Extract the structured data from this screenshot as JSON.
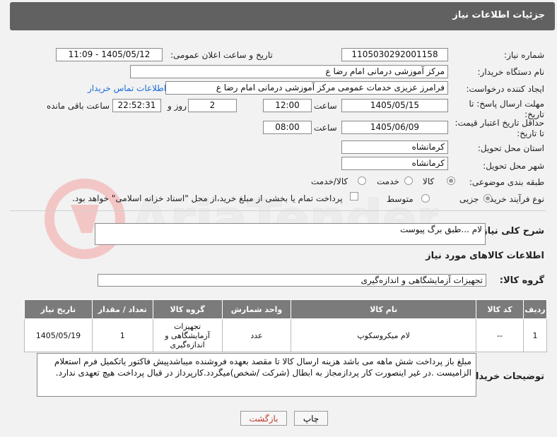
{
  "header": {
    "title": "جزئیات اطلاعات نیاز"
  },
  "fields": {
    "need_number_label": "شماره نیاز:",
    "need_number": "1105030292001158",
    "announce_label": "تاریخ و ساعت اعلان عمومی:",
    "announce_value": "1405/05/12 - 11:09",
    "buyer_org_label": "نام دستگاه خریدار:",
    "buyer_org": "مرکز آموزشی  درمانی امام رضا  ع",
    "requester_label": "ایجاد کننده درخواست:",
    "requester": "فرامرز عزیزی خدمات عمومی مرکز آموزشی  درمانی امام رضا  ع",
    "contact_link": "اطلاعات تماس خریدار",
    "deadline_label": "مهلت ارسال پاسخ: تا تاریخ:",
    "deadline_date": "1405/05/15",
    "time_label": "ساعت",
    "deadline_time": "12:00",
    "days_value": "2",
    "days_label": "روز و",
    "remaining_value": "22:52:31",
    "remaining_label": "ساعت باقی مانده",
    "price_validity_label": "حداقل تاریخ اعتبار قیمت: تا تاریخ:",
    "price_date": "1405/06/09",
    "price_time": "08:00",
    "province_label": "استان محل تحویل:",
    "province": "کرمانشاه",
    "city_label": "شهر محل تحویل:",
    "city": "کرمانشاه",
    "category_label": "طبقه بندی موضوعی:",
    "category_options": [
      "کالا",
      "خدمت",
      "کالا/خدمت"
    ],
    "process_label": "نوع فرآیند خرید :",
    "process_options": [
      "جزیی",
      "متوسط"
    ],
    "payment_note": "پرداخت تمام یا بخشی از مبلغ خرید،از محل \"اسناد خزانه اسلامی\" خواهد بود.",
    "description_label": "شرح کلی نیاز:",
    "description": "لام ...طبق برگ پیوست",
    "items_section": "اطلاعات کالاهای مورد نیاز",
    "group_label": "گروه کالا:",
    "group_value": "تجهیزات آزمایشگاهی و اندازه‌گیری",
    "buyer_notes_label": "توضیحات خریدار:",
    "buyer_notes": "مبلغ باز پرداخت شش ماهه می باشد هزینه ارسال کالا تا مقصد بعهده فروشنده میباشدپیش فاکتور یاتکمیل فرم استعلام الزامیست .در غیر اینصورت کار پردازمجاز به ابطال (شرکت /شخص)میگردد.کارپرداز در قبال پرداخت هیچ تعهدی ندارد."
  },
  "table": {
    "headers": [
      "ردیف",
      "کد کالا",
      "نام کالا",
      "واحد شمارش",
      "گروه کالا",
      "تعداد / مقدار",
      "تاریخ نیاز"
    ],
    "rows": [
      [
        "1",
        "--",
        "لام میکروسکوپ",
        "عدد",
        "تجهیزات آزمایشگاهی و اندازه‌گیری",
        "1",
        "1405/05/19"
      ]
    ]
  },
  "buttons": {
    "print": "چاپ",
    "back": "بازگشت"
  },
  "watermark": "AriaTender.net"
}
